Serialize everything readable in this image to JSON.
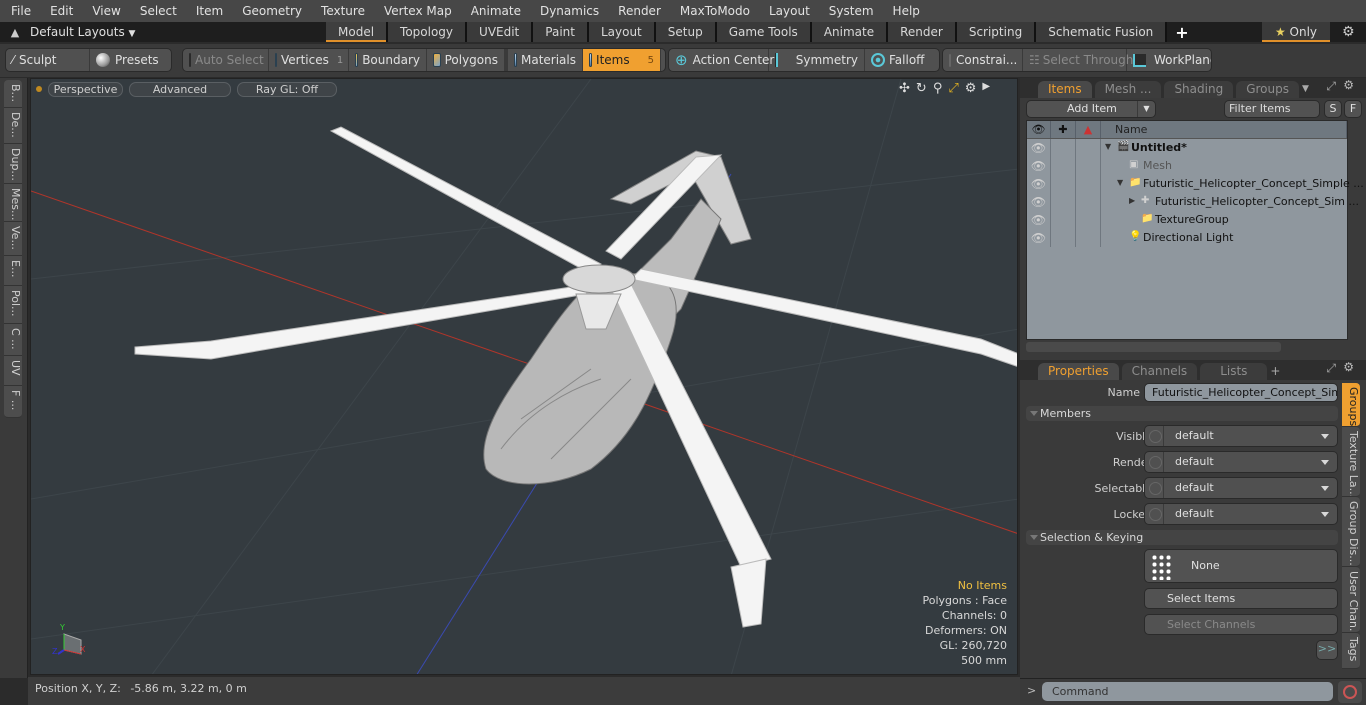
{
  "menubar": {
    "items": [
      "File",
      "Edit",
      "View",
      "Select",
      "Item",
      "Geometry",
      "Texture",
      "Vertex Map",
      "Animate",
      "Dynamics",
      "Render",
      "MaxToModo",
      "Layout",
      "System",
      "Help"
    ]
  },
  "layoutbar": {
    "layouts_label": "Default Layouts",
    "tabs": [
      "Model",
      "Topology",
      "UVEdit",
      "Paint",
      "Layout",
      "Setup",
      "Game Tools",
      "Animate",
      "Render",
      "Scripting",
      "Schematic Fusion"
    ],
    "active_tab": "Model",
    "add_label": "+",
    "only_label": "Only"
  },
  "toolbar": {
    "sculpt": "Sculpt",
    "presets": "Presets",
    "auto_select": "Auto Select",
    "vertices": "Vertices",
    "vertices_count": "1",
    "boundary": "Boundary",
    "polygons": "Polygons",
    "materials": "Materials",
    "items": "Items",
    "items_count": "5",
    "action_center": "Action Center",
    "symmetry": "Symmetry",
    "falloff": "Falloff",
    "constraints": "Constrai...",
    "select_through": "Select Through",
    "workplane": "WorkPlane"
  },
  "leftstrip": {
    "tabs": [
      "B...",
      "De...",
      "Dup...",
      "Mes...",
      "Ve...",
      "E...",
      "Pol...",
      "C ...",
      "UV",
      "F ..."
    ]
  },
  "viewport": {
    "view_mode": "Perspective",
    "shading": "Advanced",
    "raygl": "Ray GL: Off",
    "stats": {
      "selection": "No Items",
      "polygons": "Polygons : Face",
      "channels": "Channels: 0",
      "deformers": "Deformers: ON",
      "gl": "GL: 260,720",
      "scale": "500 mm"
    },
    "axis_labels": {
      "x": "X",
      "y": "Y",
      "z": "Z"
    }
  },
  "statusbar": {
    "position_label": "Position X, Y, Z:",
    "position_value": "-5.86 m, 3.22 m, 0 m"
  },
  "items_panel": {
    "tabs": [
      "Items",
      "Mesh ...",
      "Shading",
      "Groups"
    ],
    "active_tab": "Items",
    "add_item": "Add Item",
    "filter_placeholder": "Filter Items",
    "s_btn": "S",
    "f_btn": "F",
    "name_header": "Name",
    "rows": [
      {
        "name": "Untitled*",
        "type": "scene"
      },
      {
        "name": "Mesh",
        "type": "mesh"
      },
      {
        "name": "Futuristic_Helicopter_Concept_Simple ...",
        "type": "group"
      },
      {
        "name": "Futuristic_Helicopter_Concept_Sim ...",
        "type": "locator"
      },
      {
        "name": "TextureGroup",
        "type": "group"
      },
      {
        "name": "Directional Light",
        "type": "light"
      }
    ]
  },
  "properties_panel": {
    "tabs": [
      "Properties",
      "Channels",
      "Lists"
    ],
    "active_tab": "Properties",
    "add_label": "+",
    "name_label": "Name",
    "name_value": "Futuristic_Helicopter_Concept_Simple",
    "members_section": "Members",
    "fields": [
      {
        "label": "Visible",
        "value": "default"
      },
      {
        "label": "Render",
        "value": "default"
      },
      {
        "label": "Selectable",
        "value": "default"
      },
      {
        "label": "Locked",
        "value": "default"
      }
    ],
    "selection_section": "Selection & Keying",
    "none_label": "None",
    "select_items": "Select Items",
    "select_channels": "Select Channels",
    "more": ">>",
    "side_tabs": [
      "Groups",
      "Texture La...",
      "Group Dis...",
      "User Chan...",
      "Tags"
    ]
  },
  "command": {
    "prompt": ">",
    "placeholder": "Command"
  },
  "colors": {
    "accent": "#f0a030",
    "viewport_bg": "#343b40",
    "list_bg": "#8f979e"
  }
}
